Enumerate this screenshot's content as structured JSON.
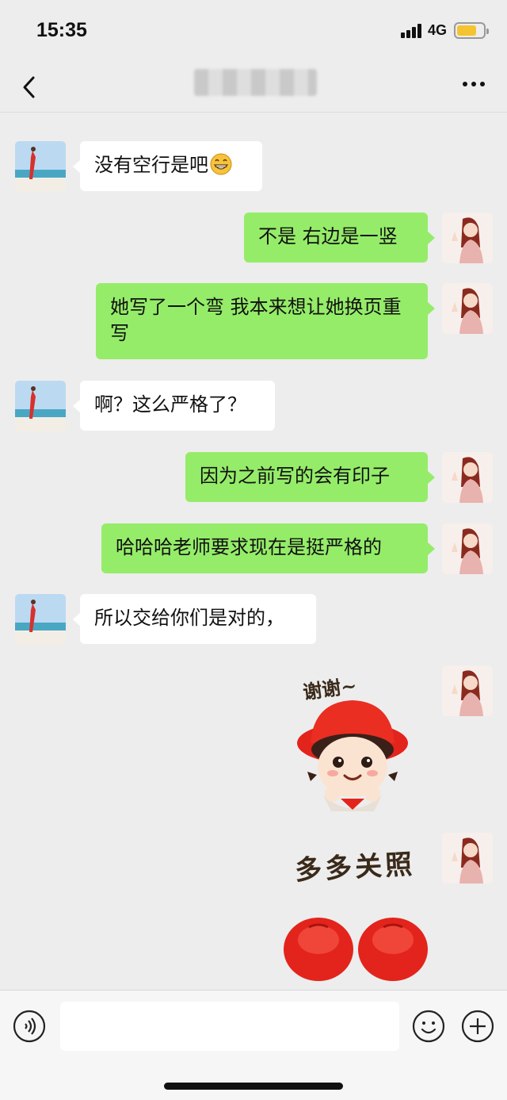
{
  "status": {
    "time": "15:35",
    "network": "4G"
  },
  "nav": {
    "back_icon": "chevron-left-icon",
    "title_blurred": true,
    "more_icon": "more-dots-icon"
  },
  "messages": [
    {
      "side": "left",
      "text": "没有空行是吧",
      "emoji": "grinning-face"
    },
    {
      "side": "right",
      "text": "不是 右边是一竖"
    },
    {
      "side": "right",
      "text": "她写了一个弯 我本来想让她换页重写"
    },
    {
      "side": "left",
      "text": "啊？这么严格了？"
    },
    {
      "side": "right",
      "text": "因为之前写的会有印子"
    },
    {
      "side": "right",
      "text": "哈哈哈老师要求现在是挺严格的"
    },
    {
      "side": "left",
      "text": "所以交给你们是对的，"
    },
    {
      "side": "right",
      "sticker": "girl-red-hat",
      "sticker_text": "谢谢~"
    },
    {
      "side": "right",
      "sticker": "text-sticker",
      "sticker_text": "多多关照"
    },
    {
      "side": "right",
      "sticker": "red-hat-partial"
    }
  ],
  "input": {
    "value": "",
    "voice_icon": "voice-icon",
    "emoji_icon": "emoji-icon",
    "plus_icon": "plus-icon"
  },
  "colors": {
    "background": "#ededed",
    "bubble_right": "#95ec69",
    "bubble_left": "#ffffff"
  }
}
